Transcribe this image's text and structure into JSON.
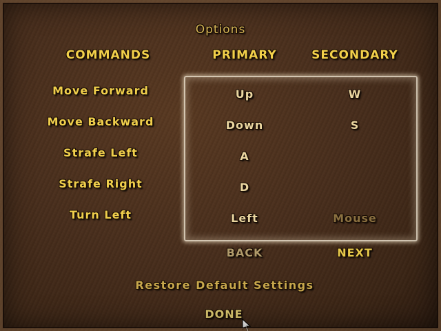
{
  "title": "Options",
  "headers": {
    "commands": "COMMANDS",
    "primary": "PRIMARY",
    "secondary": "SECONDARY"
  },
  "bindings": [
    {
      "command": "Move Forward",
      "primary": "Up",
      "secondary": "W"
    },
    {
      "command": "Move Backward",
      "primary": "Down",
      "secondary": "S"
    },
    {
      "command": "Strafe Left",
      "primary": "A",
      "secondary": ""
    },
    {
      "command": "Strafe Right",
      "primary": "D",
      "secondary": ""
    },
    {
      "command": "Turn Left",
      "primary": "Left",
      "secondary": "Mouse"
    }
  ],
  "nav": {
    "back": "BACK",
    "next": "NEXT"
  },
  "restore": "Restore Default Settings",
  "done": "DONE",
  "colors": {
    "background": "#4a2f1d",
    "text_gold": "#f0cf4c",
    "frame": "#f5ebd7",
    "disabled": "#8a7040"
  },
  "icons": {
    "cursor": "arrow-cursor-icon"
  }
}
